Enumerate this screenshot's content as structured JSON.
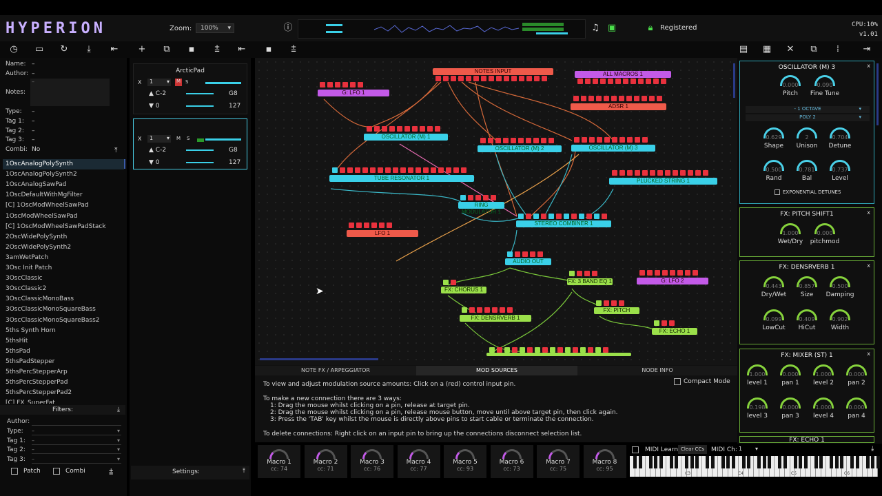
{
  "app": {
    "logo": "HYPERION",
    "zoom_label": "Zoom:",
    "zoom_value": "100%",
    "registered": "Registered",
    "cpu": "CPU:10%",
    "version": "v1.01"
  },
  "info_panel": {
    "name_label": "Name:",
    "name": "–",
    "author_label": "Author:",
    "author": "–",
    "notes_label": "Notes:",
    "notes": "–",
    "type_label": "Type:",
    "type": "–",
    "tag1_label": "Tag 1:",
    "tag1": "–",
    "tag2_label": "Tag 2:",
    "tag2": "–",
    "tag3_label": "Tag 3:",
    "tag3": "–",
    "combi_label": "Combi:",
    "combi": "No"
  },
  "presets": [
    "1OscAnalogPolySynth",
    "1OscAnalogPolySynth2",
    "1OscAnalogSawPad",
    "1OscDefaultWithMgFilter",
    "[C] 1OscModWheelSawPad",
    "1OscModWheelSawPad",
    "[C] 1OscModWheelSawPadStack",
    "2OscWidePolySynth",
    "2OscWidePolySynth2",
    "3amWetPatch",
    "3Osc Init Patch",
    "3OscClassic",
    "3OscClassic2",
    "3OscClassicMonoBass",
    "3OscClassicMonoSquareBass",
    "3OscClassicMonoSquareBass2",
    "5ths Synth Horn",
    "5thsHit",
    "5thsPad",
    "5thsPadStepper",
    "5thsPercStepperArp",
    "5thsPercStepperPad",
    "5thsPercStepperPad2",
    "[C] FX_SuperFat"
  ],
  "filters": {
    "title": "Filters:",
    "author_label": "Author:",
    "type_label": "Type:",
    "tag1_label": "Tag 1:",
    "tag2_label": "Tag 2:",
    "tag3_label": "Tag 3:",
    "value": "–",
    "patch": "Patch",
    "combi": "Combi"
  },
  "layers": {
    "name": "ArcticPad",
    "channel": "1",
    "low_note": "C-2",
    "high_note": "G8",
    "vel_low": "0",
    "vel_high": "127",
    "m": "M",
    "s": "S",
    "x": "X",
    "settings": "Settings:"
  },
  "nodes": {
    "notes_input": "NOTES INPUT",
    "all_macros": "ALL MACROS 1",
    "glfo1": "G: LFO 1",
    "adsr": "ADSR 1",
    "osc1": "OSCILLATOR (M) 1",
    "osc2": "OSCILLATOR (M) 2",
    "osc3": "OSCILLATOR (M) 3",
    "tube": "TUBE RESONATOR 1",
    "plucked": "PLUCKED STRING 1",
    "ringmod": "RING MODULATOR 1",
    "combiner": "STEREO COMBINER 1",
    "lfo1": "LFO 1",
    "audio_out": "AUDIO OUT",
    "chorus": "FX: CHORUS 1",
    "eq": "FX: 3 BAND EQ 1",
    "glfo2": "G: LFO 2",
    "densrverb": "FX: DENSRVERB 1",
    "pitchshift": "FX: PITCH SHIFT1",
    "echo": "FX: ECHO 1"
  },
  "tabs": {
    "notefx": "NOTE FX / ARPEGGIATOR",
    "modsources": "MOD SOURCES",
    "nodeinfo": "NODE INFO"
  },
  "info_text": {
    "compact": "Compact Mode",
    "l1": "To view and adjust modulation source amounts: Click on a (red) control input pin.",
    "l2": "To make a new connection there are 3 ways:",
    "l3": "1: Drag the mouse whilst clicking on a pin, release at target pin.",
    "l4": "2: Drag the mouse whilst clicking on a pin, release mouse button, move until above target pin, then click again.",
    "l5": "3: Press the 'TAB' key whilst the mouse is directly above pins to start cable or terminate the connection.",
    "l6": "To delete connections: Right click on an input pin to bring up the connections disconnect selection list."
  },
  "macros": [
    {
      "name": "Macro 1",
      "cc": "cc: 74"
    },
    {
      "name": "Macro 2",
      "cc": "cc: 71"
    },
    {
      "name": "Macro 3",
      "cc": "cc: 76"
    },
    {
      "name": "Macro 4",
      "cc": "cc: 77"
    },
    {
      "name": "Macro 5",
      "cc": "cc: 93"
    },
    {
      "name": "Macro 6",
      "cc": "cc: 73"
    },
    {
      "name": "Macro 7",
      "cc": "cc: 75"
    },
    {
      "name": "Macro 8",
      "cc": "cc: 95"
    }
  ],
  "midi": {
    "learn": "MIDI Learn",
    "clear": "Clear CCs",
    "ch_label": "MIDI Ch:",
    "ch": "1",
    "c3": "C3",
    "c4": "C4",
    "c5": "C5",
    "c6": "C6"
  },
  "osc_panel": {
    "title": "OSCILLATOR (M) 3",
    "octave": "- 1 OCTAVE",
    "poly": "POLY 2",
    "exp": "EXPONENTIAL DETUNES",
    "knobs": [
      {
        "v": "0.000",
        "l": "Pitch"
      },
      {
        "v": "0.090",
        "l": "Fine Tune"
      },
      {
        "v": "0.629",
        "l": "Shape"
      },
      {
        "v": "2",
        "l": "Unison"
      },
      {
        "v": "0.704",
        "l": "Detune"
      },
      {
        "v": "0.500",
        "l": "Rand"
      },
      {
        "v": "0.781",
        "l": "Bal"
      },
      {
        "v": "0.737",
        "l": "Level"
      }
    ]
  },
  "pitch_panel": {
    "title": "FX: PITCH SHIFT1",
    "knobs": [
      {
        "v": "1.000",
        "l": "Wet/Dry"
      },
      {
        "v": "0.000",
        "l": "pitchmod"
      }
    ]
  },
  "dens_panel": {
    "title": "FX: DENSRVERB 1",
    "knobs": [
      {
        "v": "0.443",
        "l": "Dry/Wet"
      },
      {
        "v": "0.857",
        "l": "Size"
      },
      {
        "v": "0.500",
        "l": "Damping"
      },
      {
        "v": "0.099",
        "l": "LowCut"
      },
      {
        "v": "0.409",
        "l": "HiCut"
      },
      {
        "v": "0.902",
        "l": "Width"
      }
    ]
  },
  "mixer_panel": {
    "title": "FX: MIXER (ST) 1",
    "knobs": [
      {
        "v": "1.000",
        "l": "level 1"
      },
      {
        "v": "0.000",
        "l": "pan 1"
      },
      {
        "v": "1.000",
        "l": "level 2"
      },
      {
        "v": "0.000",
        "l": "pan 2"
      },
      {
        "v": "0.198",
        "l": "level 3"
      },
      {
        "v": "0.000",
        "l": "pan 3"
      },
      {
        "v": "1.000",
        "l": "level 4"
      },
      {
        "v": "0.000",
        "l": "pan 4"
      }
    ]
  },
  "echo_panel": {
    "title": "FX: ECHO 1"
  }
}
